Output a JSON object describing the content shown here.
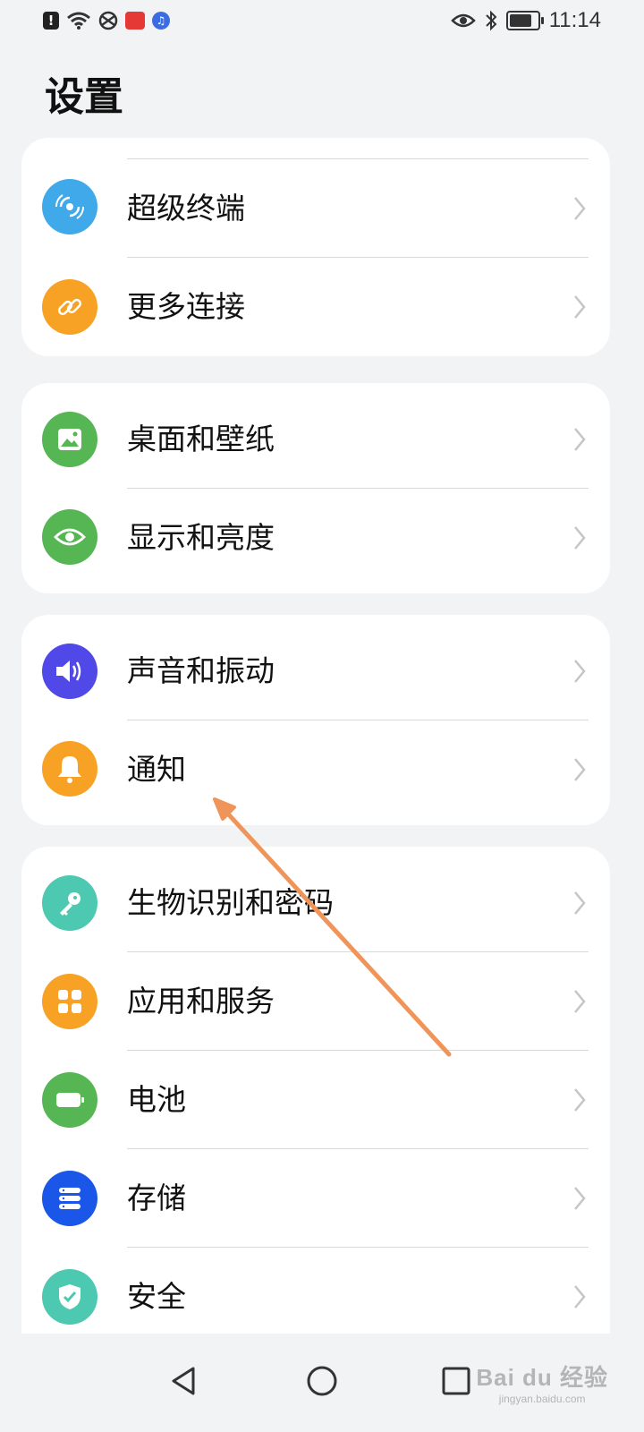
{
  "status_bar": {
    "time": "11:14",
    "battery_level": 0.7,
    "left_icons": [
      "notification-alert-icon",
      "wifi-icon",
      "network-icon",
      "app-badge-icon",
      "music-icon"
    ],
    "right_icons": [
      "eye-icon",
      "bluetooth-icon",
      "battery-icon"
    ]
  },
  "page": {
    "title": "设置"
  },
  "sections": [
    {
      "items": [
        {
          "label": "超级终端",
          "icon": "super-device-icon",
          "color": "#3fa9e9"
        },
        {
          "label": "更多连接",
          "icon": "link-icon",
          "color": "#f7a224"
        }
      ]
    },
    {
      "items": [
        {
          "label": "桌面和壁纸",
          "icon": "wallpaper-icon",
          "color": "#56b654"
        },
        {
          "label": "显示和亮度",
          "icon": "eye-icon",
          "color": "#56b654"
        }
      ]
    },
    {
      "items": [
        {
          "label": "声音和振动",
          "icon": "speaker-icon",
          "color": "#5148e8"
        },
        {
          "label": "通知",
          "icon": "bell-icon",
          "color": "#f7a224"
        }
      ]
    },
    {
      "items": [
        {
          "label": "生物识别和密码",
          "icon": "key-icon",
          "color": "#4cc9b0"
        },
        {
          "label": "应用和服务",
          "icon": "apps-grid-icon",
          "color": "#f7a224"
        },
        {
          "label": "电池",
          "icon": "battery-icon",
          "color": "#56b654"
        },
        {
          "label": "存储",
          "icon": "storage-icon",
          "color": "#1a57e8"
        },
        {
          "label": "安全",
          "icon": "shield-icon",
          "color": "#4cc9b0"
        }
      ]
    }
  ],
  "nav_bar": {
    "buttons": [
      "back-icon",
      "home-icon",
      "recents-icon"
    ]
  },
  "watermark": {
    "main": "Bai du 经验",
    "sub": "jingyan.baidu.com"
  }
}
